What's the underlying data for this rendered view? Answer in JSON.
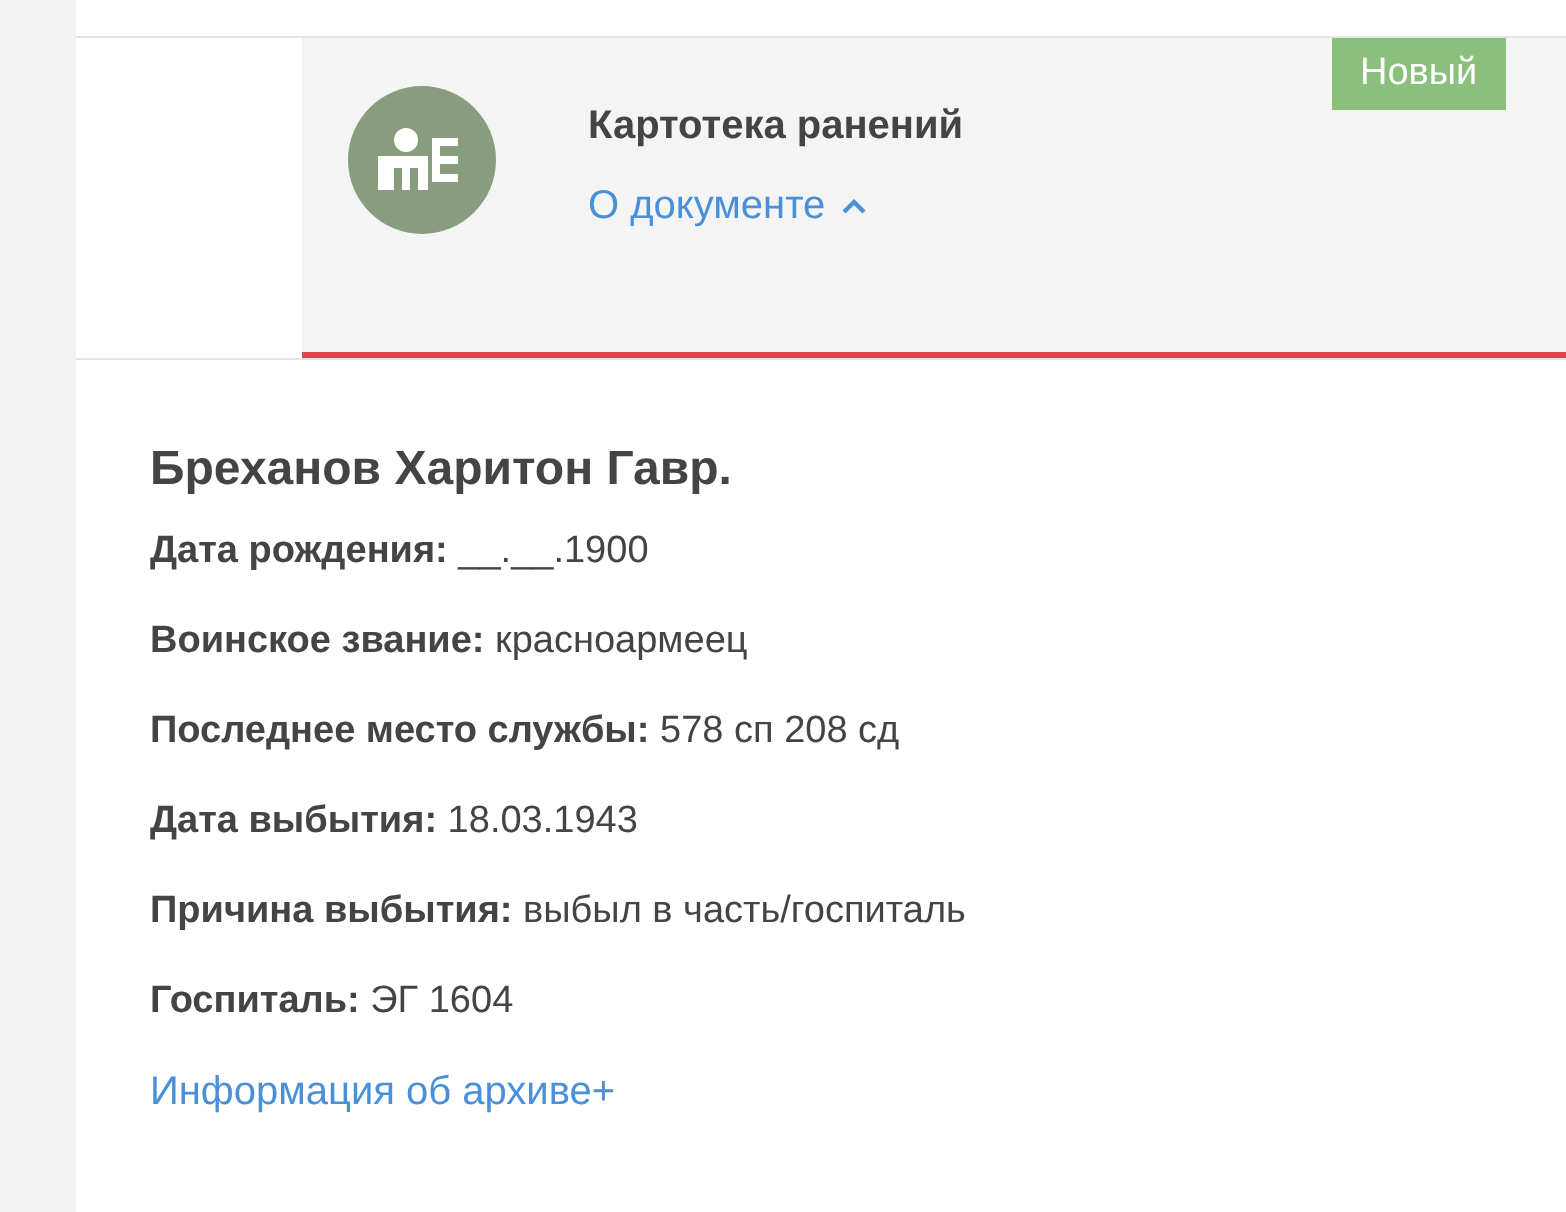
{
  "document": {
    "title": "Картотека ранений",
    "details_link": {
      "label": "О документе",
      "expanded": true
    },
    "badge": "Новый"
  },
  "person": {
    "name": "Бреханов Харитон Гавр.",
    "fields": [
      {
        "label": "Дата рождения:",
        "value": "__.__.1900"
      },
      {
        "label": "Воинское звание:",
        "value": "красноармеец"
      },
      {
        "label": "Последнее место службы:",
        "value": "578 сп 208 сд"
      },
      {
        "label": "Дата выбытия:",
        "value": "18.03.1943"
      },
      {
        "label": "Причина выбытия:",
        "value": "выбыл в часть/госпиталь"
      },
      {
        "label": "Госпиталь:",
        "value": "ЭГ 1604"
      }
    ],
    "archive_link": "Информация об архиве+"
  }
}
